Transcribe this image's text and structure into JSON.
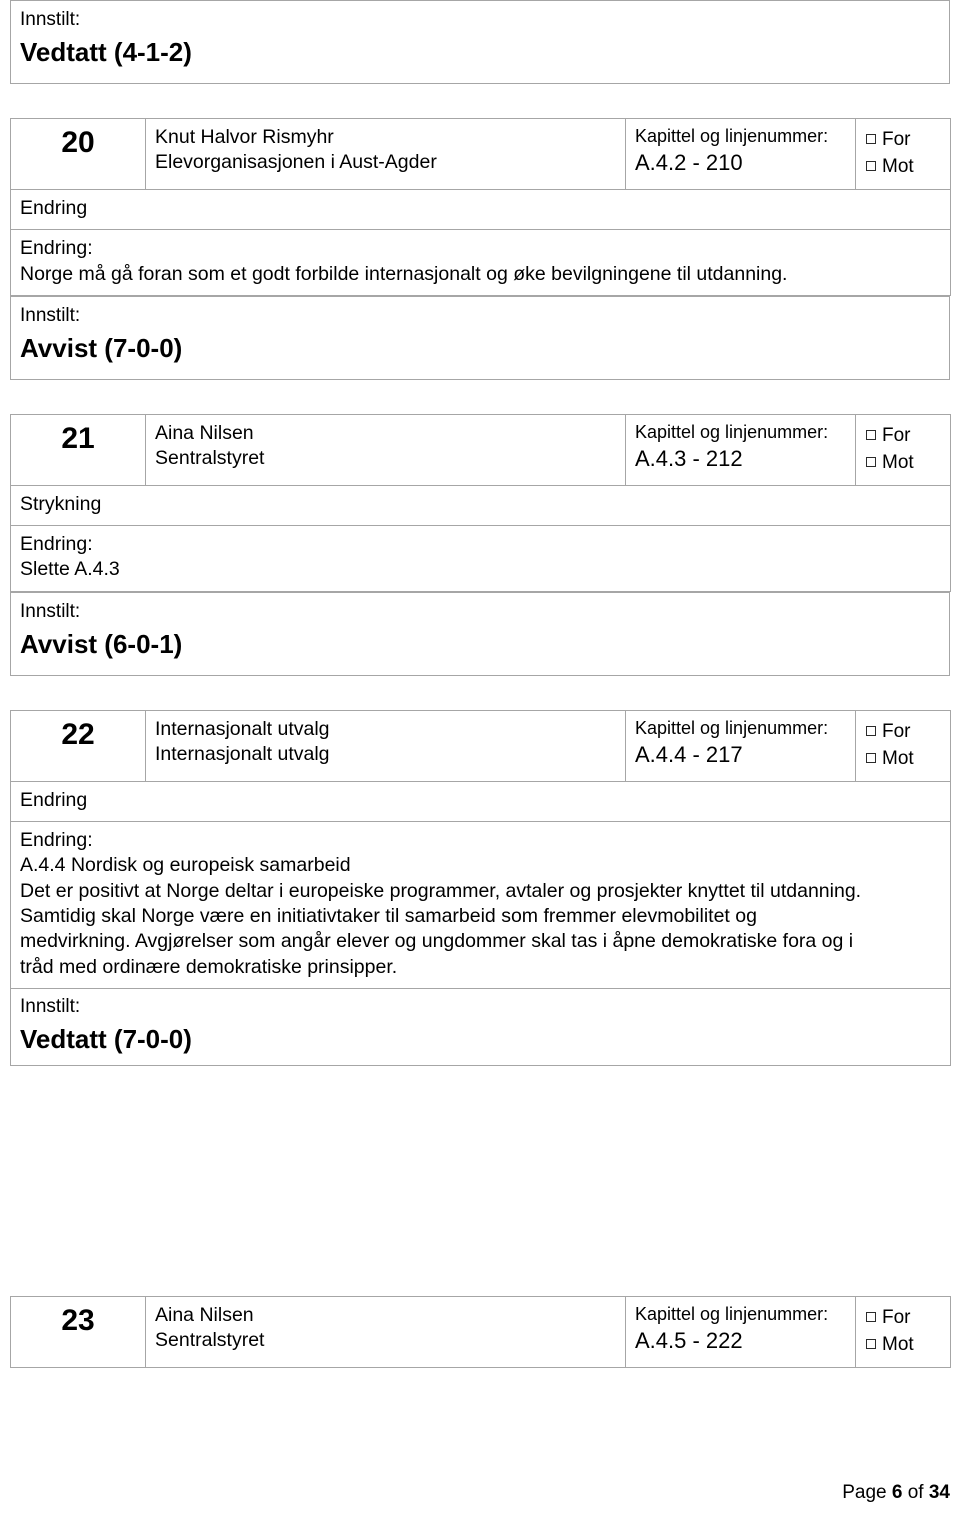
{
  "labels": {
    "innstilt": "Innstilt:",
    "endring": "Endring",
    "endring_colon": "Endring:",
    "strykning": "Strykning",
    "kapittel": "Kapittel og linjenummer:",
    "for": "For",
    "mot": "Mot"
  },
  "top_result": {
    "label": "Innstilt:",
    "verdict": "Vedtatt (4-1-2)"
  },
  "entries": [
    {
      "number": "20",
      "proposer": "Knut Halvor Rismyhr",
      "organization": "Elevorganisasjonen i Aust-Agder",
      "chapter_label": "Kapittel og linjenummer:",
      "chapter_value": "A.4.2 - 210",
      "vote_for": "For",
      "vote_against": "Mot",
      "type_label": "Endring",
      "change_label": "Endring:",
      "change_lines": [
        "Norge må gå foran som et godt forbilde internasjonalt og øke bevilgningene til utdanning."
      ],
      "result_label": "Innstilt:",
      "result_verdict": "Avvist (7-0-0)"
    },
    {
      "number": "21",
      "proposer": "Aina Nilsen",
      "organization": "Sentralstyret",
      "chapter_label": "Kapittel og linjenummer:",
      "chapter_value": "A.4.3 - 212",
      "vote_for": "For",
      "vote_against": "Mot",
      "type_label": "Strykning",
      "change_label": "Endring:",
      "change_lines": [
        "Slette A.4.3"
      ],
      "result_label": "Innstilt:",
      "result_verdict": "Avvist (6-0-1)"
    },
    {
      "number": "22",
      "proposer": "Internasjonalt utvalg",
      "organization": "Internasjonalt utvalg",
      "chapter_label": "Kapittel og linjenummer:",
      "chapter_value": "A.4.4 - 217",
      "vote_for": "For",
      "vote_against": "Mot",
      "type_label": "Endring",
      "change_label": "Endring:",
      "change_lines": [
        "A.4.4 Nordisk og europeisk samarbeid",
        " Det er positivt at Norge deltar i europeiske programmer, avtaler og prosjekter knyttet til utdanning.",
        "Samtidig skal Norge være en initiativtaker til samarbeid som fremmer elevmobilitet og",
        "medvirkning. Avgjørelser som angår elever og ungdommer skal tas i åpne demokratiske fora og i",
        "tråd med ordinære demokratiske prinsipper."
      ],
      "result_label": "Innstilt:",
      "result_verdict": "Vedtatt (7-0-0)"
    },
    {
      "number": "23",
      "proposer": "Aina Nilsen",
      "organization": "Sentralstyret",
      "chapter_label": "Kapittel og linjenummer:",
      "chapter_value": "A.4.5 - 222",
      "vote_for": "For",
      "vote_against": "Mot"
    }
  ],
  "footer": {
    "prefix": "Page ",
    "current": "6",
    "middle": " of ",
    "total": "34"
  }
}
